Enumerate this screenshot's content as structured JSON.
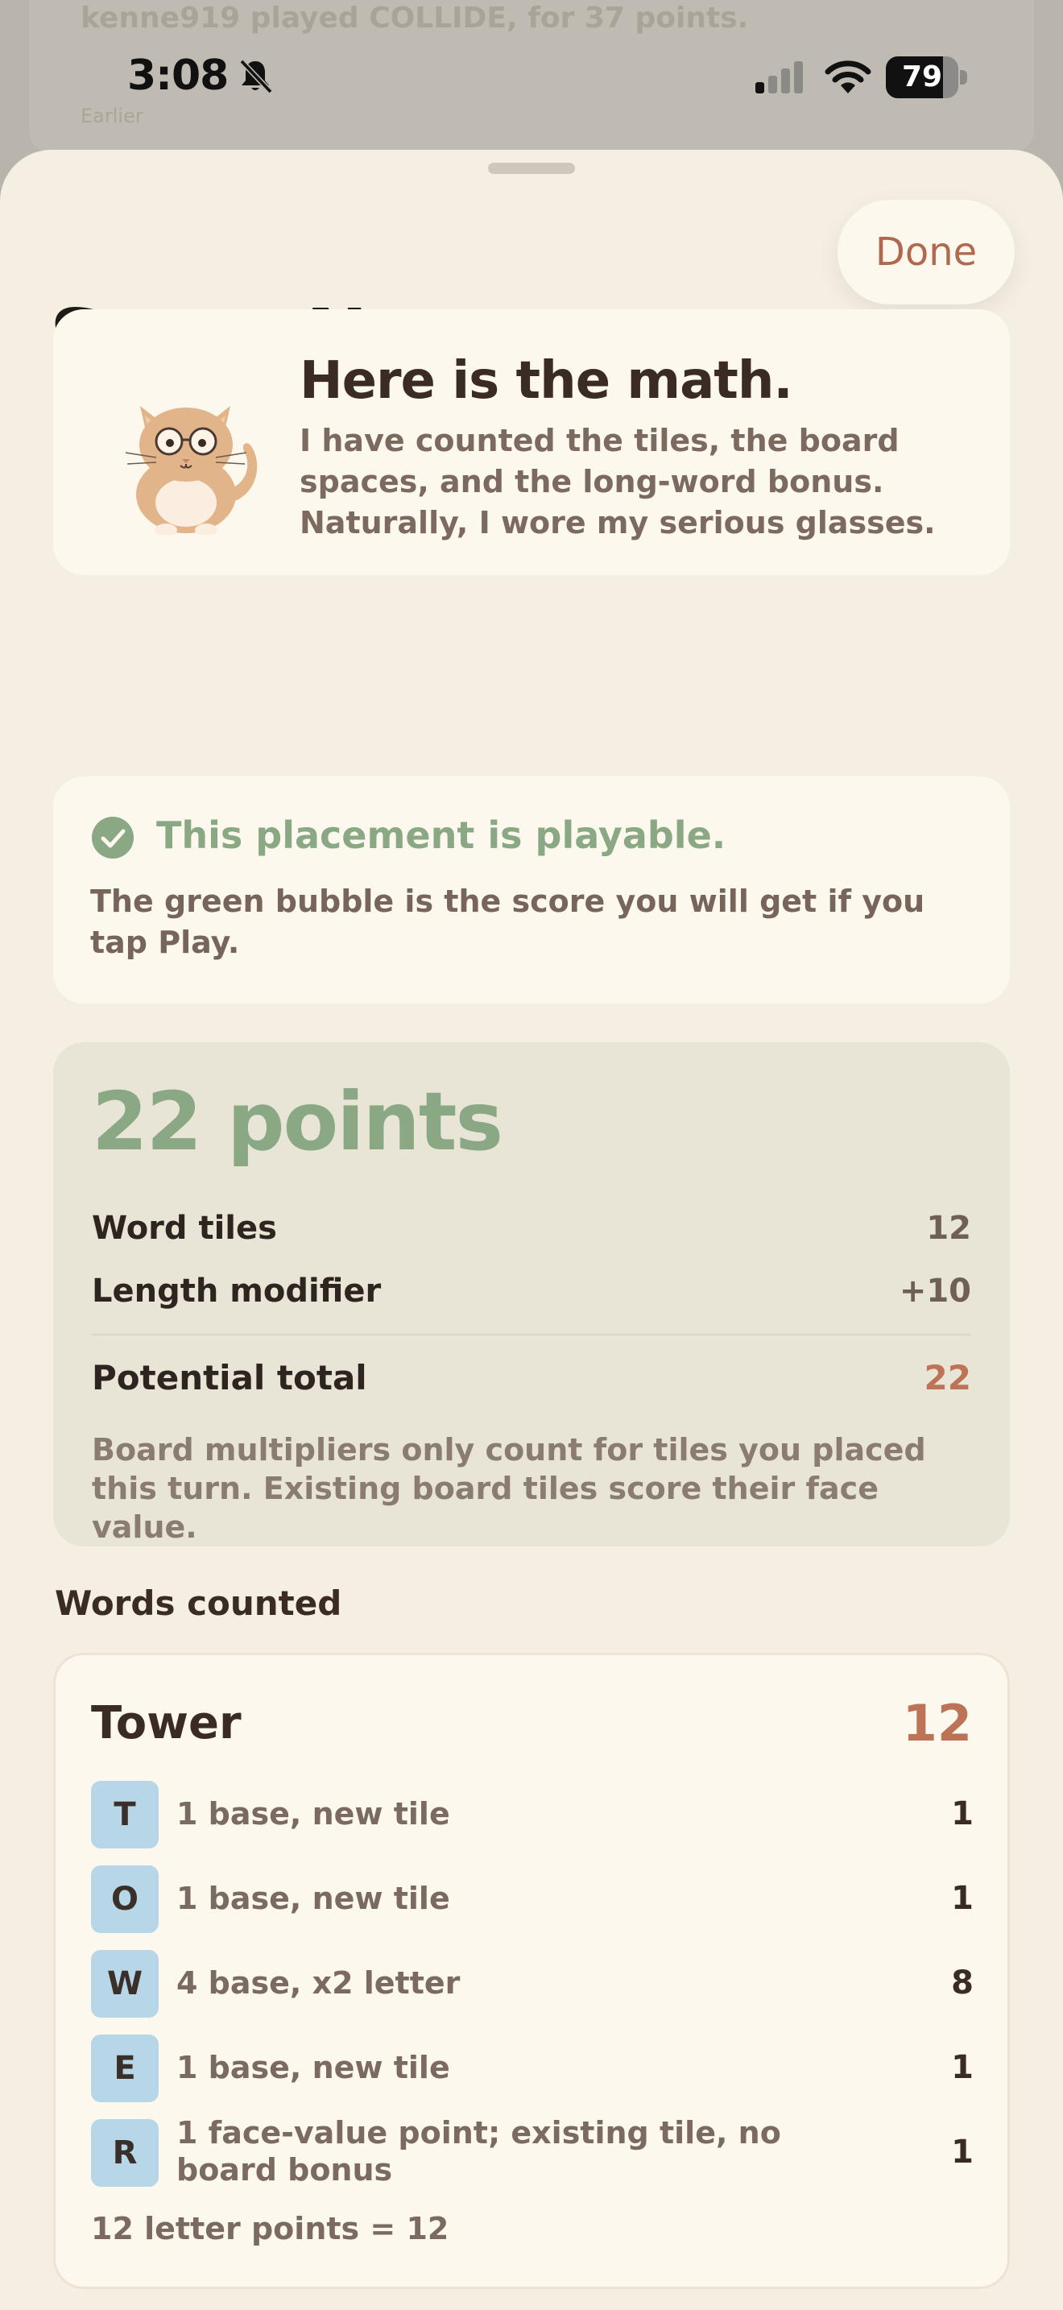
{
  "background": {
    "feed_text": "kenne919 played COLLIDE, for 37 points.",
    "feed_sub": "Earlier"
  },
  "status_bar": {
    "time": "3:08",
    "battery": "79",
    "battery_level": 0.79
  },
  "header": {
    "done_label": "Done",
    "title": "Score Notes"
  },
  "intro": {
    "title": "Here is the math.",
    "body": "I have counted the tiles, the board spaces, and the long-word bonus. Naturally, I wore my serious glasses."
  },
  "placement": {
    "heading": "This placement is playable.",
    "body": "The green bubble is the score you will get if you tap Play."
  },
  "score": {
    "total": "22 points",
    "rows": [
      {
        "label": "Word tiles",
        "value": "12"
      },
      {
        "label": "Length modifier",
        "value": "+10"
      },
      {
        "label": "Potential total",
        "value": "22"
      }
    ],
    "note": "Board multipliers only count for tiles you placed this turn. Existing board tiles score their face value."
  },
  "words_section": {
    "label": "Words counted",
    "word": "Tower",
    "word_score": "12",
    "letters": [
      {
        "letter": "T",
        "desc": "1 base, new tile",
        "points": "1"
      },
      {
        "letter": "O",
        "desc": "1 base, new tile",
        "points": "1"
      },
      {
        "letter": "W",
        "desc": "4 base, x2 letter",
        "points": "8"
      },
      {
        "letter": "E",
        "desc": "1 base, new tile",
        "points": "1"
      },
      {
        "letter": "R",
        "desc": "1 face-value point; existing tile, no board bonus",
        "points": "1"
      }
    ],
    "summary": "12 letter points = 12"
  },
  "colors": {
    "accent_green": "#8aa883",
    "accent_orange": "#bd7456",
    "tile_blue": "#b7d7e8",
    "sheet": "#f5eee3"
  }
}
